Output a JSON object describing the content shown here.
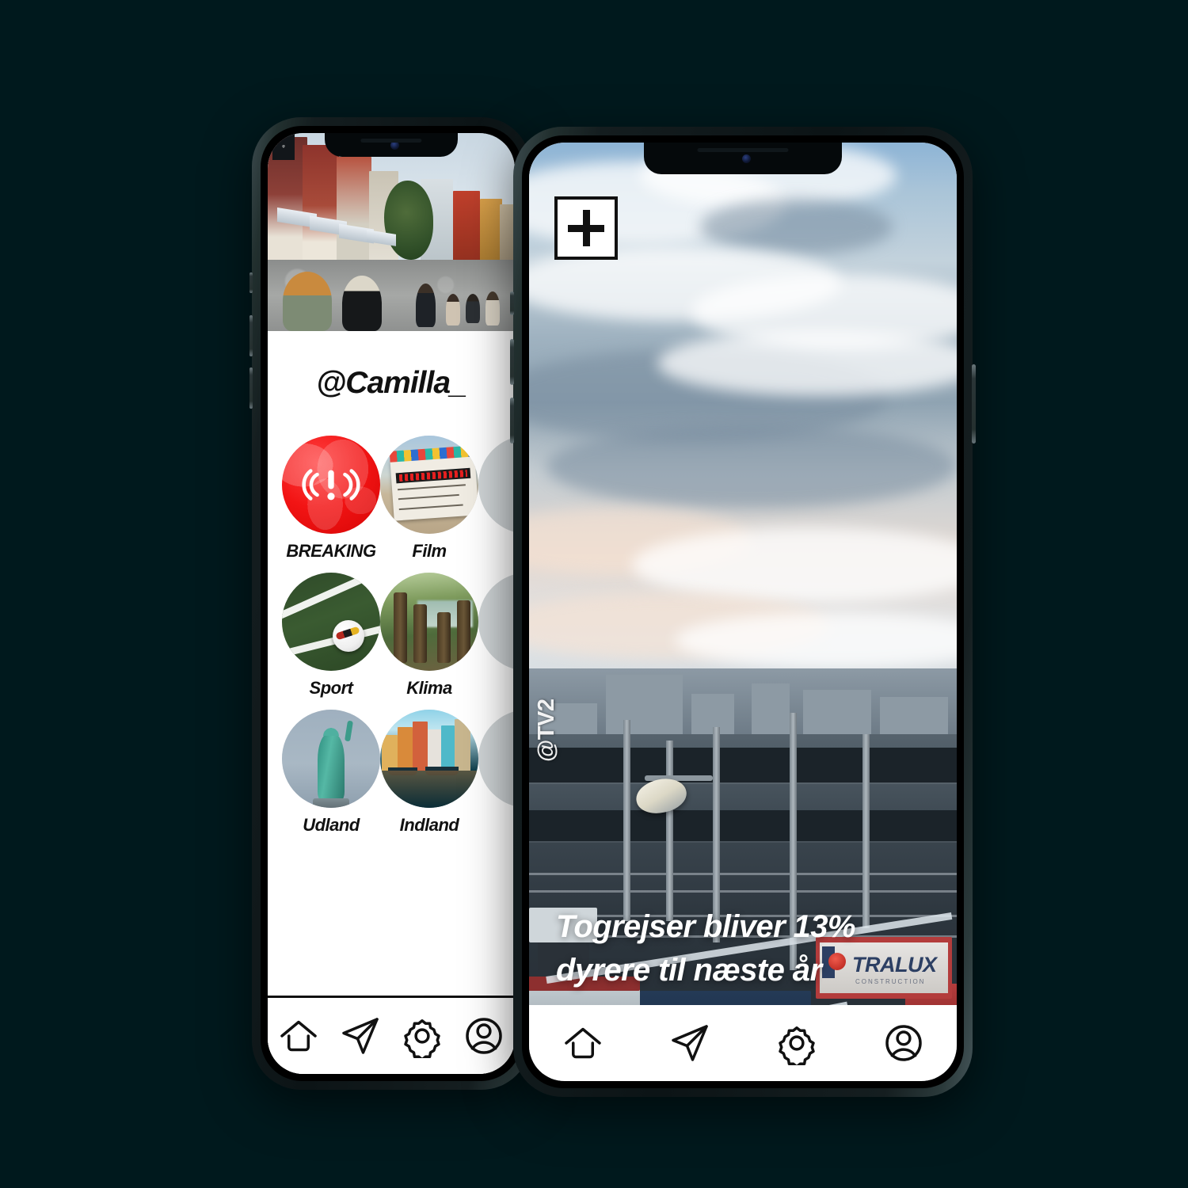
{
  "background_color": "#00191d",
  "back_phone": {
    "hero_image_alt": "copenhagen-pedestrian-street",
    "profile_handle": "@Camilla_",
    "categories": [
      {
        "label": "BREAKING",
        "icon": "breaking-news-globe-icon",
        "thumb": "red-globe"
      },
      {
        "label": "Film",
        "icon": "clapperboard-icon",
        "thumb": "film-clapperboard"
      },
      {
        "label": "Sport",
        "icon": "football-icon",
        "thumb": "soccer-ball-pitch"
      },
      {
        "label": "Klima",
        "icon": "forest-icon",
        "thumb": "forest-lake"
      },
      {
        "label": "Udland",
        "icon": "statue-of-liberty-icon",
        "thumb": "statue-of-liberty"
      },
      {
        "label": "Indland",
        "icon": "nyhavn-icon",
        "thumb": "nyhavn-harbour"
      }
    ],
    "nav": [
      {
        "name": "home",
        "label": "Home"
      },
      {
        "name": "send",
        "label": "Send"
      },
      {
        "name": "settings",
        "label": "Settings"
      },
      {
        "name": "profile",
        "label": "Profile"
      }
    ]
  },
  "front_phone": {
    "add_button_label": "+",
    "watermark": "@TV2",
    "headline": "Togrejser bliver 13% dyrere til næste år",
    "story_image_alt": "railway-yard-copenhagen",
    "sponsor_sign": {
      "name": "TRALUX",
      "subtitle": "CONSTRUCTION"
    },
    "nav": [
      {
        "name": "home",
        "label": "Home"
      },
      {
        "name": "send",
        "label": "Send"
      },
      {
        "name": "settings",
        "label": "Settings"
      },
      {
        "name": "profile",
        "label": "Profile"
      }
    ]
  }
}
